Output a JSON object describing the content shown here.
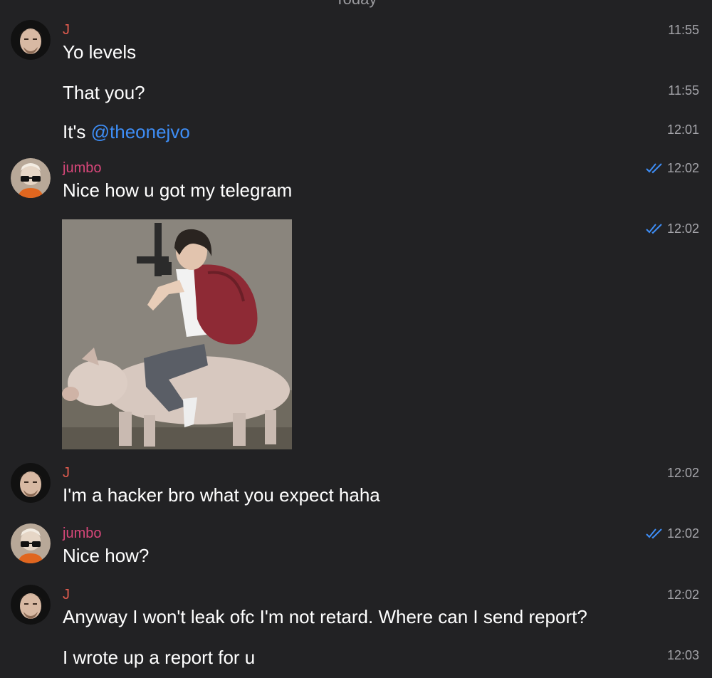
{
  "chat": {
    "date_separator": "Today",
    "check_color": "#3e8ef7",
    "mention_color": "#3e8ef7",
    "sender_colors": {
      "J": "#e25c4f",
      "jumbo": "#d9477a"
    },
    "messages": [
      {
        "sender": "J",
        "text": "Yo levels",
        "time": "11:55"
      },
      {
        "text": "That you?",
        "time": "11:55"
      },
      {
        "text_prefix": "It's ",
        "mention": "@theonejvo",
        "time": "12:01"
      },
      {
        "sender": "jumbo",
        "text": "Nice how u got my telegram",
        "time": "12:02",
        "read": true
      },
      {
        "photo": "photo-person-riding-pig-with-gun",
        "time": "12:02",
        "read": true
      },
      {
        "sender": "J",
        "text": "I'm a hacker bro what you expect haha",
        "time": "12:02"
      },
      {
        "sender": "jumbo",
        "text": "Nice how?",
        "time": "12:02",
        "read": true
      },
      {
        "sender": "J",
        "text": "Anyway I won't leak ofc I'm not retard. Where can I send report?",
        "time": "12:02"
      },
      {
        "text": "I wrote up a report for u",
        "time": "12:03"
      }
    ]
  }
}
